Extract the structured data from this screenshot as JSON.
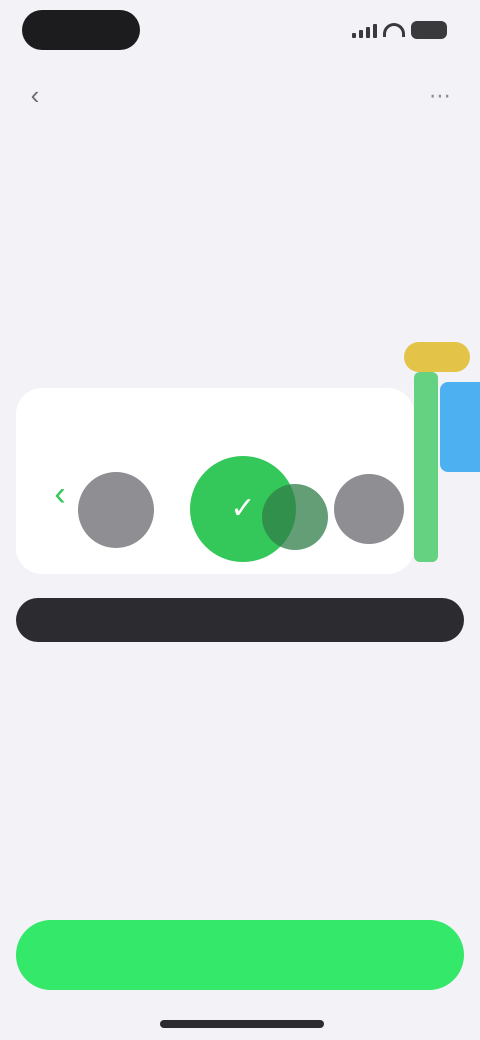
{
  "nav": {
    "back_icon": "back-chevron-icon",
    "title": "",
    "menu_icon": "more-icon"
  },
  "section": {
    "title": "",
    "badge": ""
  },
  "carousel": {
    "items": [
      "gray-circle",
      "green-circle-selected",
      "gray-circle"
    ],
    "center_icon": "check-icon"
  },
  "info_bar": {
    "text": ""
  },
  "sub_text": "",
  "primary_button": {
    "label": ""
  },
  "colors": {
    "background": "#f2f2f7",
    "accent_green": "#34c759",
    "button_green": "#34e86a",
    "dark": "#2c2c30",
    "badge_yellow": "#e3c448",
    "blue": "#3ba9f0"
  }
}
